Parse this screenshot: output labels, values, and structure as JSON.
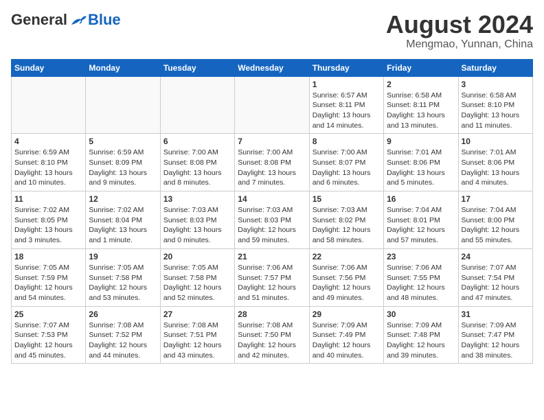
{
  "header": {
    "logo_general": "General",
    "logo_blue": "Blue",
    "month_year": "August 2024",
    "location": "Mengmao, Yunnan, China"
  },
  "weekdays": [
    "Sunday",
    "Monday",
    "Tuesday",
    "Wednesday",
    "Thursday",
    "Friday",
    "Saturday"
  ],
  "weeks": [
    [
      {
        "day": "",
        "info": ""
      },
      {
        "day": "",
        "info": ""
      },
      {
        "day": "",
        "info": ""
      },
      {
        "day": "",
        "info": ""
      },
      {
        "day": "1",
        "info": "Sunrise: 6:57 AM\nSunset: 8:11 PM\nDaylight: 13 hours\nand 14 minutes."
      },
      {
        "day": "2",
        "info": "Sunrise: 6:58 AM\nSunset: 8:11 PM\nDaylight: 13 hours\nand 13 minutes."
      },
      {
        "day": "3",
        "info": "Sunrise: 6:58 AM\nSunset: 8:10 PM\nDaylight: 13 hours\nand 11 minutes."
      }
    ],
    [
      {
        "day": "4",
        "info": "Sunrise: 6:59 AM\nSunset: 8:10 PM\nDaylight: 13 hours\nand 10 minutes."
      },
      {
        "day": "5",
        "info": "Sunrise: 6:59 AM\nSunset: 8:09 PM\nDaylight: 13 hours\nand 9 minutes."
      },
      {
        "day": "6",
        "info": "Sunrise: 7:00 AM\nSunset: 8:08 PM\nDaylight: 13 hours\nand 8 minutes."
      },
      {
        "day": "7",
        "info": "Sunrise: 7:00 AM\nSunset: 8:08 PM\nDaylight: 13 hours\nand 7 minutes."
      },
      {
        "day": "8",
        "info": "Sunrise: 7:00 AM\nSunset: 8:07 PM\nDaylight: 13 hours\nand 6 minutes."
      },
      {
        "day": "9",
        "info": "Sunrise: 7:01 AM\nSunset: 8:06 PM\nDaylight: 13 hours\nand 5 minutes."
      },
      {
        "day": "10",
        "info": "Sunrise: 7:01 AM\nSunset: 8:06 PM\nDaylight: 13 hours\nand 4 minutes."
      }
    ],
    [
      {
        "day": "11",
        "info": "Sunrise: 7:02 AM\nSunset: 8:05 PM\nDaylight: 13 hours\nand 3 minutes."
      },
      {
        "day": "12",
        "info": "Sunrise: 7:02 AM\nSunset: 8:04 PM\nDaylight: 13 hours\nand 1 minute."
      },
      {
        "day": "13",
        "info": "Sunrise: 7:03 AM\nSunset: 8:03 PM\nDaylight: 13 hours\nand 0 minutes."
      },
      {
        "day": "14",
        "info": "Sunrise: 7:03 AM\nSunset: 8:03 PM\nDaylight: 12 hours\nand 59 minutes."
      },
      {
        "day": "15",
        "info": "Sunrise: 7:03 AM\nSunset: 8:02 PM\nDaylight: 12 hours\nand 58 minutes."
      },
      {
        "day": "16",
        "info": "Sunrise: 7:04 AM\nSunset: 8:01 PM\nDaylight: 12 hours\nand 57 minutes."
      },
      {
        "day": "17",
        "info": "Sunrise: 7:04 AM\nSunset: 8:00 PM\nDaylight: 12 hours\nand 55 minutes."
      }
    ],
    [
      {
        "day": "18",
        "info": "Sunrise: 7:05 AM\nSunset: 7:59 PM\nDaylight: 12 hours\nand 54 minutes."
      },
      {
        "day": "19",
        "info": "Sunrise: 7:05 AM\nSunset: 7:58 PM\nDaylight: 12 hours\nand 53 minutes."
      },
      {
        "day": "20",
        "info": "Sunrise: 7:05 AM\nSunset: 7:58 PM\nDaylight: 12 hours\nand 52 minutes."
      },
      {
        "day": "21",
        "info": "Sunrise: 7:06 AM\nSunset: 7:57 PM\nDaylight: 12 hours\nand 51 minutes."
      },
      {
        "day": "22",
        "info": "Sunrise: 7:06 AM\nSunset: 7:56 PM\nDaylight: 12 hours\nand 49 minutes."
      },
      {
        "day": "23",
        "info": "Sunrise: 7:06 AM\nSunset: 7:55 PM\nDaylight: 12 hours\nand 48 minutes."
      },
      {
        "day": "24",
        "info": "Sunrise: 7:07 AM\nSunset: 7:54 PM\nDaylight: 12 hours\nand 47 minutes."
      }
    ],
    [
      {
        "day": "25",
        "info": "Sunrise: 7:07 AM\nSunset: 7:53 PM\nDaylight: 12 hours\nand 45 minutes."
      },
      {
        "day": "26",
        "info": "Sunrise: 7:08 AM\nSunset: 7:52 PM\nDaylight: 12 hours\nand 44 minutes."
      },
      {
        "day": "27",
        "info": "Sunrise: 7:08 AM\nSunset: 7:51 PM\nDaylight: 12 hours\nand 43 minutes."
      },
      {
        "day": "28",
        "info": "Sunrise: 7:08 AM\nSunset: 7:50 PM\nDaylight: 12 hours\nand 42 minutes."
      },
      {
        "day": "29",
        "info": "Sunrise: 7:09 AM\nSunset: 7:49 PM\nDaylight: 12 hours\nand 40 minutes."
      },
      {
        "day": "30",
        "info": "Sunrise: 7:09 AM\nSunset: 7:48 PM\nDaylight: 12 hours\nand 39 minutes."
      },
      {
        "day": "31",
        "info": "Sunrise: 7:09 AM\nSunset: 7:47 PM\nDaylight: 12 hours\nand 38 minutes."
      }
    ]
  ]
}
